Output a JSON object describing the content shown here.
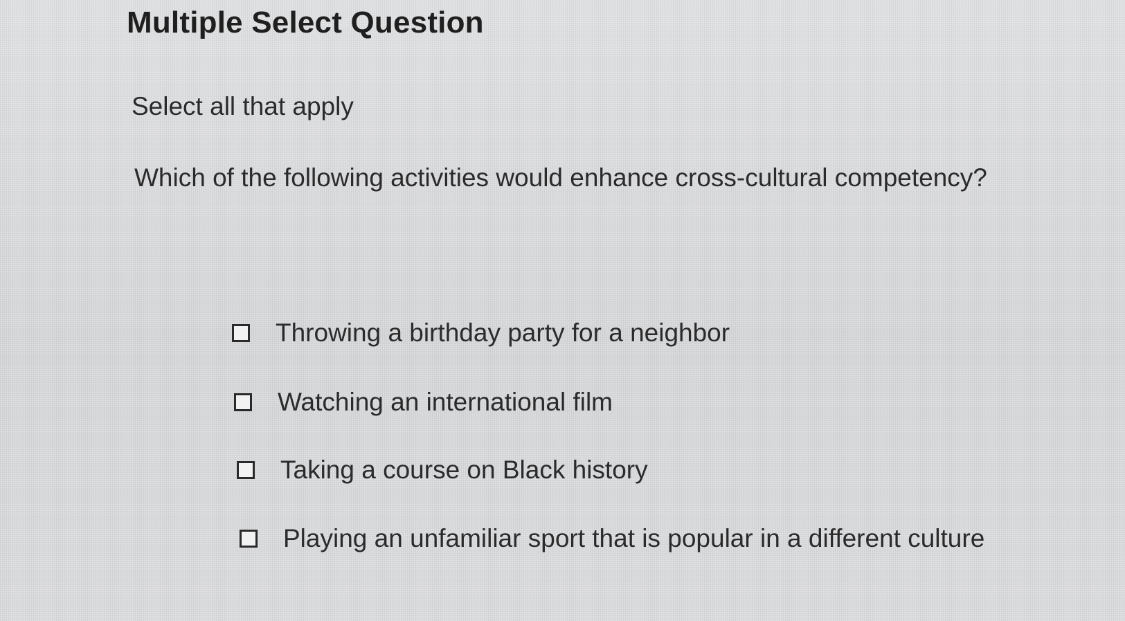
{
  "question": {
    "title": "Multiple Select Question",
    "instruction": "Select all that apply",
    "prompt": "Which of the following activities would enhance cross-cultural competency?",
    "options": [
      {
        "label": "Throwing a birthday party for a neighbor",
        "checked": false
      },
      {
        "label": "Watching an international film",
        "checked": false
      },
      {
        "label": "Taking a course on Black history",
        "checked": false
      },
      {
        "label": "Playing an unfamiliar sport that is popular in a different culture",
        "checked": false
      }
    ]
  }
}
